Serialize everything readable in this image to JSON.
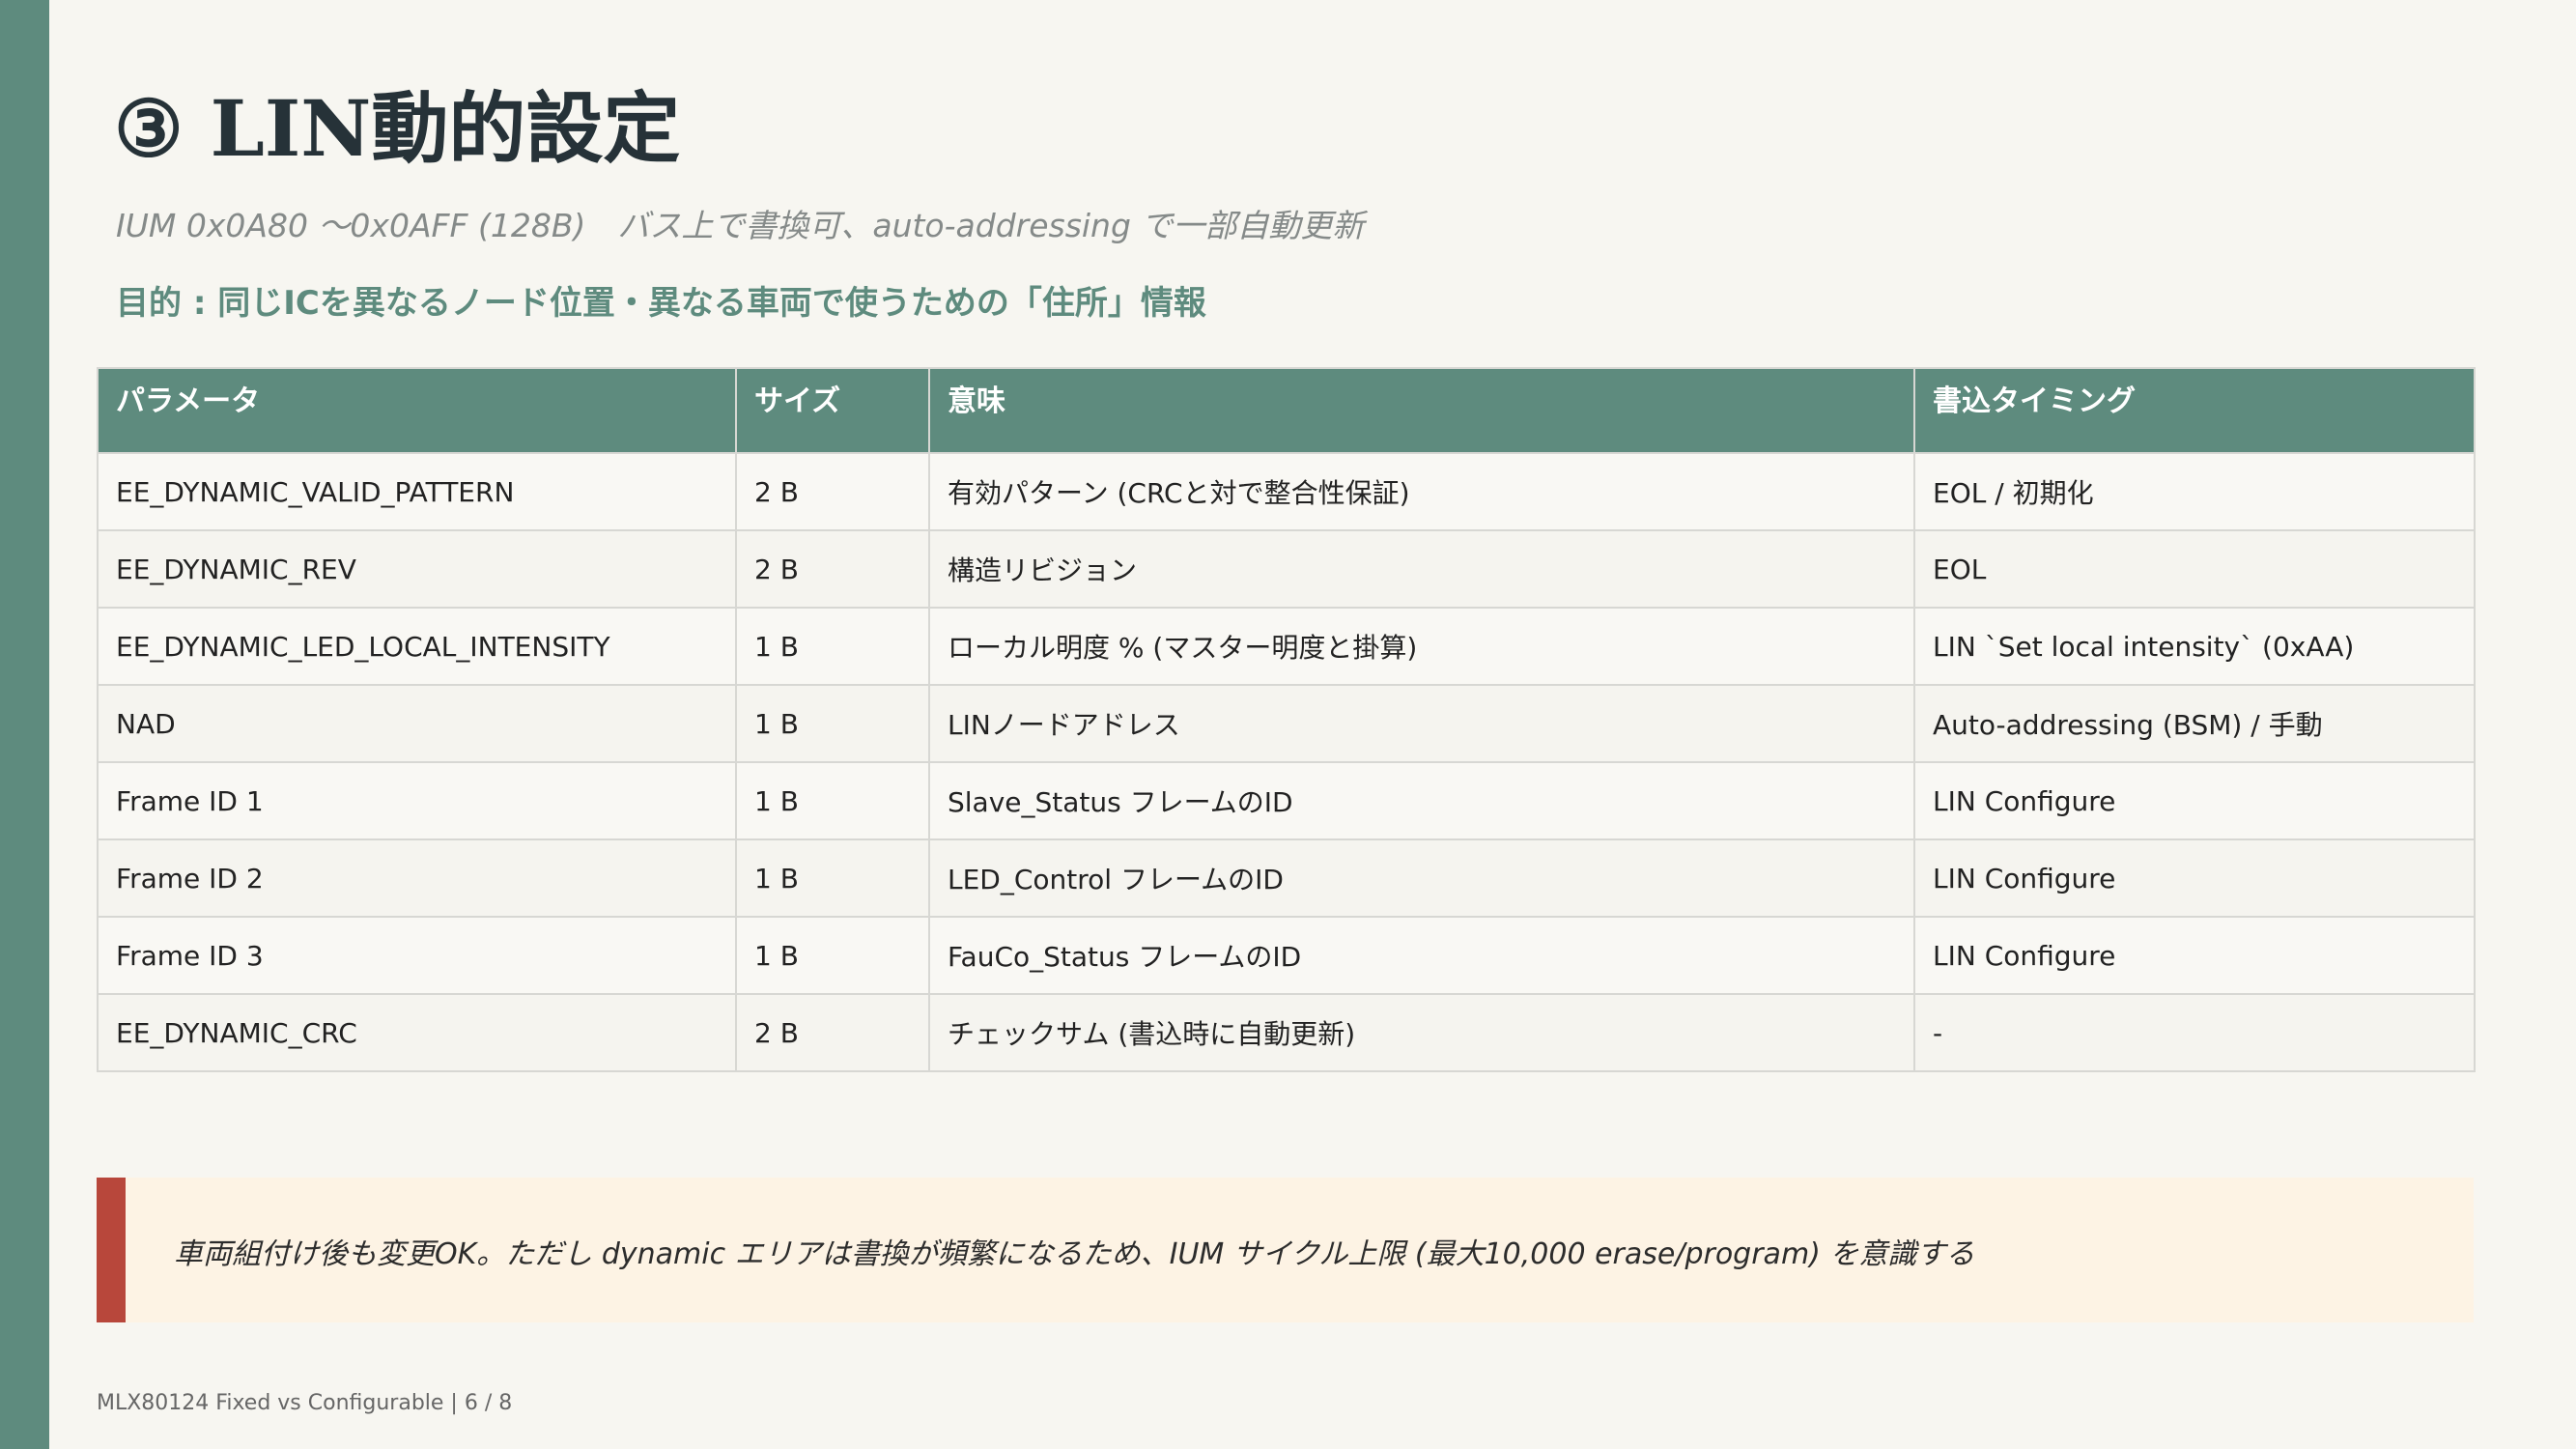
{
  "title": "③ LIN動的設定",
  "subtitle": "IUM 0x0A80 〜0x0AFF (128B)　バス上で書換可、auto-addressing で一部自動更新",
  "purpose": "目的 : 同じICを異なるノード位置・異なる車両で使うための「住所」情報",
  "table": {
    "headers": [
      "パラメータ",
      "サイズ",
      "意味",
      "書込タイミング"
    ],
    "rows": [
      [
        "EE_DYNAMIC_VALID_PATTERN",
        "2 B",
        "有効パターン (CRCと対で整合性保証)",
        "EOL / 初期化"
      ],
      [
        "EE_DYNAMIC_REV",
        "2 B",
        "構造リビジョン",
        "EOL"
      ],
      [
        "EE_DYNAMIC_LED_LOCAL_INTENSITY",
        "1 B",
        "ローカル明度 % (マスター明度と掛算)",
        "LIN `Set local intensity` (0xAA)"
      ],
      [
        "NAD",
        "1 B",
        "LINノードアドレス",
        "Auto-addressing (BSM) / 手動"
      ],
      [
        "Frame ID 1",
        "1 B",
        "Slave_Status フレームのID",
        "LIN Configure"
      ],
      [
        "Frame ID 2",
        "1 B",
        "LED_Control フレームのID",
        "LIN Configure"
      ],
      [
        "Frame ID 3",
        "1 B",
        "FauCo_Status フレームのID",
        "LIN Configure"
      ],
      [
        "EE_DYNAMIC_CRC",
        "2 B",
        "チェックサム (書込時に自動更新)",
        "-"
      ]
    ]
  },
  "note": "車両組付け後も変更OK。ただし dynamic エリアは書換が頻繁になるため、IUM サイクル上限 (最大10,000 erase/program) を意識する",
  "footer": "MLX80124 Fixed vs Configurable  |  6 / 8",
  "colors": {
    "accent": "#5e8b7e",
    "note_accent": "#b8473b",
    "note_background": "#fdf3e4",
    "background": "#f7f6f1"
  }
}
